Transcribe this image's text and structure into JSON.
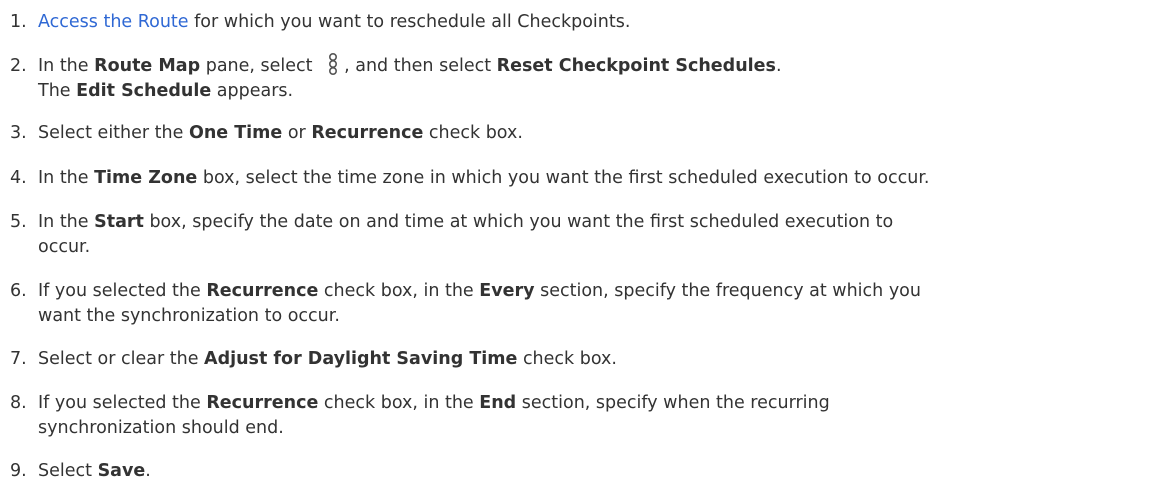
{
  "steps": [
    {
      "number": "1.",
      "link_text": "Access the Route",
      "text": " for which you want to reschedule all Checkpoints."
    },
    {
      "number": "2.",
      "t1": "In the ",
      "b1": "Route Map",
      "t2": " pane, select ",
      "icon": "more-options-kebab-icon",
      "t3": ", and then select ",
      "b2": "Reset Checkpoint Schedules",
      "t4": ".",
      "result_b": "Edit Schedule",
      "result_t": " appears.",
      "result_prefix": "The "
    },
    {
      "number": "3.",
      "t1": "Select either the ",
      "b1": "One Time",
      "t2": " or ",
      "b2": "Recurrence",
      "t3": " check box."
    },
    {
      "number": "4.",
      "t1": "In the ",
      "b1": "Time Zone",
      "t2": " box, select the time zone in which you want the first scheduled execution to occur."
    },
    {
      "number": "5.",
      "t1": "In the ",
      "b1": "Start",
      "t2": " box, specify the date on and time at which you want the first scheduled execution to",
      "t3": "occur."
    },
    {
      "number": "6.",
      "t1": "If you selected the ",
      "b1": "Recurrence",
      "t2": " check box, in the ",
      "b2": "Every",
      "t3": " section, specify the frequency at which you",
      "t4": "want the synchronization to occur."
    },
    {
      "number": "7.",
      "t1": "Select or clear the ",
      "b1": "Adjust for Daylight Saving Time",
      "t2": " check box."
    },
    {
      "number": "8.",
      "t1": "If you selected the ",
      "b1": "Recurrence",
      "t2": " check box, in the ",
      "b2": "End",
      "t3": " section, specify when the recurring",
      "t4": "synchronization should end."
    },
    {
      "number": "9.",
      "t1": "Select ",
      "b1": "Save",
      "t2": "."
    }
  ],
  "colors": {
    "link": "#2f68d4",
    "text": "#333333"
  }
}
